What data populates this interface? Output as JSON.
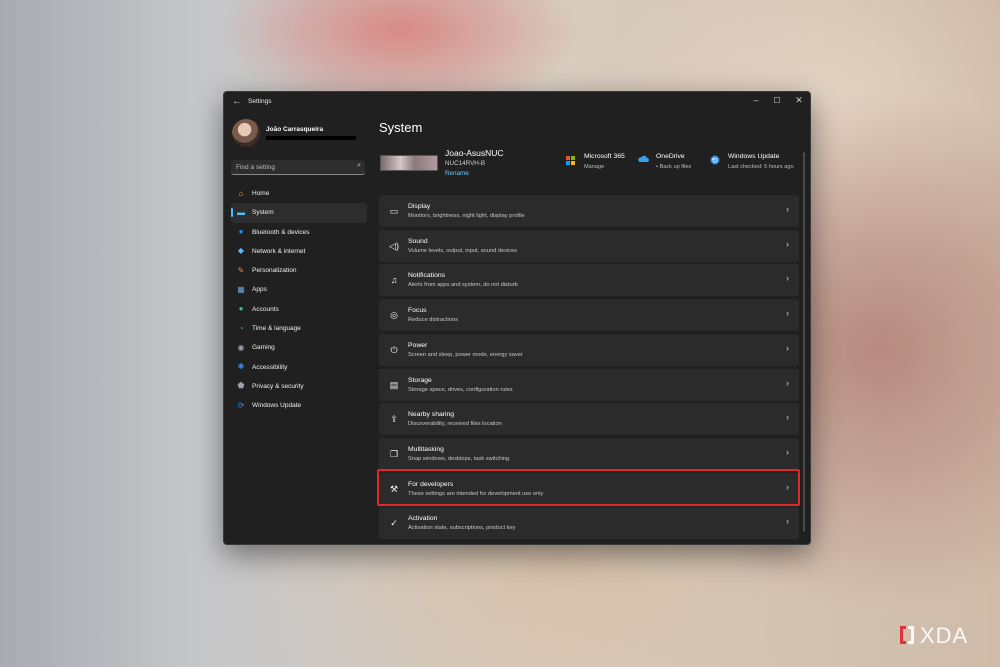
{
  "window": {
    "title": "Settings"
  },
  "profile": {
    "name": "João Carrasqueira"
  },
  "search": {
    "placeholder": "Find a setting"
  },
  "nav": [
    {
      "label": "Home",
      "icon": "home-icon",
      "color": "#e8a45c"
    },
    {
      "label": "System",
      "icon": "system-icon",
      "color": "#4cc2ff"
    },
    {
      "label": "Bluetooth & devices",
      "icon": "bluetooth-icon",
      "color": "#2a8ff2"
    },
    {
      "label": "Network & internet",
      "icon": "network-icon",
      "color": "#5fb6f5"
    },
    {
      "label": "Personalization",
      "icon": "personalization-icon",
      "color": "#e48a58"
    },
    {
      "label": "Apps",
      "icon": "apps-icon",
      "color": "#6e9ed8"
    },
    {
      "label": "Accounts",
      "icon": "accounts-icon",
      "color": "#3fbf7f"
    },
    {
      "label": "Time & language",
      "icon": "time-language-icon",
      "color": "#3aa0e8"
    },
    {
      "label": "Gaming",
      "icon": "gaming-icon",
      "color": "#9aa3ad"
    },
    {
      "label": "Accessibility",
      "icon": "accessibility-icon",
      "color": "#3a8fe8"
    },
    {
      "label": "Privacy & security",
      "icon": "shield-icon",
      "color": "#9aa3ad"
    },
    {
      "label": "Windows Update",
      "icon": "windows-update-icon",
      "color": "#2a8ff2"
    }
  ],
  "main": {
    "title": "System",
    "device": {
      "name": "Joao-AsusNUC",
      "model": "NUC14RVH-B",
      "rename": "Rename"
    },
    "quick": [
      {
        "title": "Microsoft 365",
        "sub": "Manage",
        "icon": "microsoft-365-icon"
      },
      {
        "title": "OneDrive",
        "sub": "• Back up files",
        "icon": "onedrive-icon"
      },
      {
        "title": "Windows Update",
        "sub": "Last checked: 5 hours ago",
        "icon": "windows-update-icon"
      }
    ],
    "rows": [
      {
        "title": "Display",
        "sub": "Monitors, brightness, night light, display profile",
        "icon": "display-icon"
      },
      {
        "title": "Sound",
        "sub": "Volume levels, output, input, sound devices",
        "icon": "sound-icon"
      },
      {
        "title": "Notifications",
        "sub": "Alerts from apps and system, do not disturb",
        "icon": "bell-icon"
      },
      {
        "title": "Focus",
        "sub": "Reduce distractions",
        "icon": "focus-icon"
      },
      {
        "title": "Power",
        "sub": "Screen and sleep, power mode, energy saver",
        "icon": "power-icon"
      },
      {
        "title": "Storage",
        "sub": "Storage space, drives, configuration rules",
        "icon": "storage-icon"
      },
      {
        "title": "Nearby sharing",
        "sub": "Discoverability, received files location",
        "icon": "share-icon"
      },
      {
        "title": "Multitasking",
        "sub": "Snap windows, desktops, task switching",
        "icon": "multitasking-icon"
      },
      {
        "title": "For developers",
        "sub": "These settings are intended for development use only",
        "icon": "developer-tools-icon"
      },
      {
        "title": "Activation",
        "sub": "Activation state, subscriptions, product key",
        "icon": "activation-icon"
      }
    ]
  },
  "watermark": {
    "text": "XDA"
  }
}
